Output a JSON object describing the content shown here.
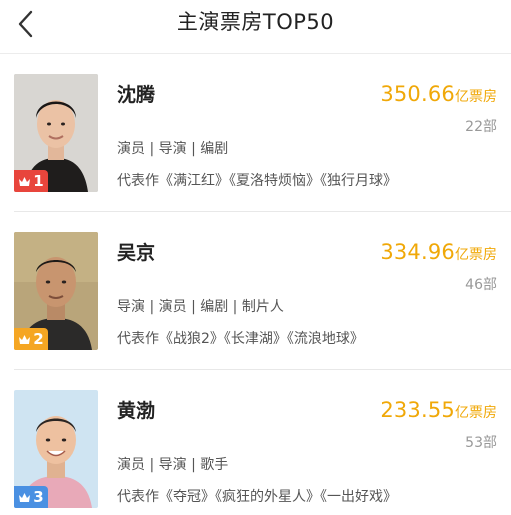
{
  "header": {
    "title": "主演票房TOP50",
    "back_icon": "chevron-left-icon"
  },
  "actors": [
    {
      "rank": "1",
      "name": "沈腾",
      "boxoffice": "350.66",
      "unit": "亿票房",
      "count": "22部",
      "roles": "演员 | 导演 | 编剧",
      "works": "代表作《满江红》《夏洛特烦恼》《独行月球》",
      "badge_color": "#e8453c"
    },
    {
      "rank": "2",
      "name": "吴京",
      "boxoffice": "334.96",
      "unit": "亿票房",
      "count": "46部",
      "roles": "导演 | 演员 | 编剧 | 制片人",
      "works": "代表作《战狼2》《长津湖》《流浪地球》",
      "badge_color": "#f5a623"
    },
    {
      "rank": "3",
      "name": "黄渤",
      "boxoffice": "233.55",
      "unit": "亿票房",
      "count": "53部",
      "roles": "演员 | 导演 | 歌手",
      "works": "代表作《夺冠》《疯狂的外星人》《一出好戏》",
      "badge_color": "#4a90e2"
    }
  ],
  "colors": {
    "accent": "#f0a808",
    "muted": "#999999"
  }
}
